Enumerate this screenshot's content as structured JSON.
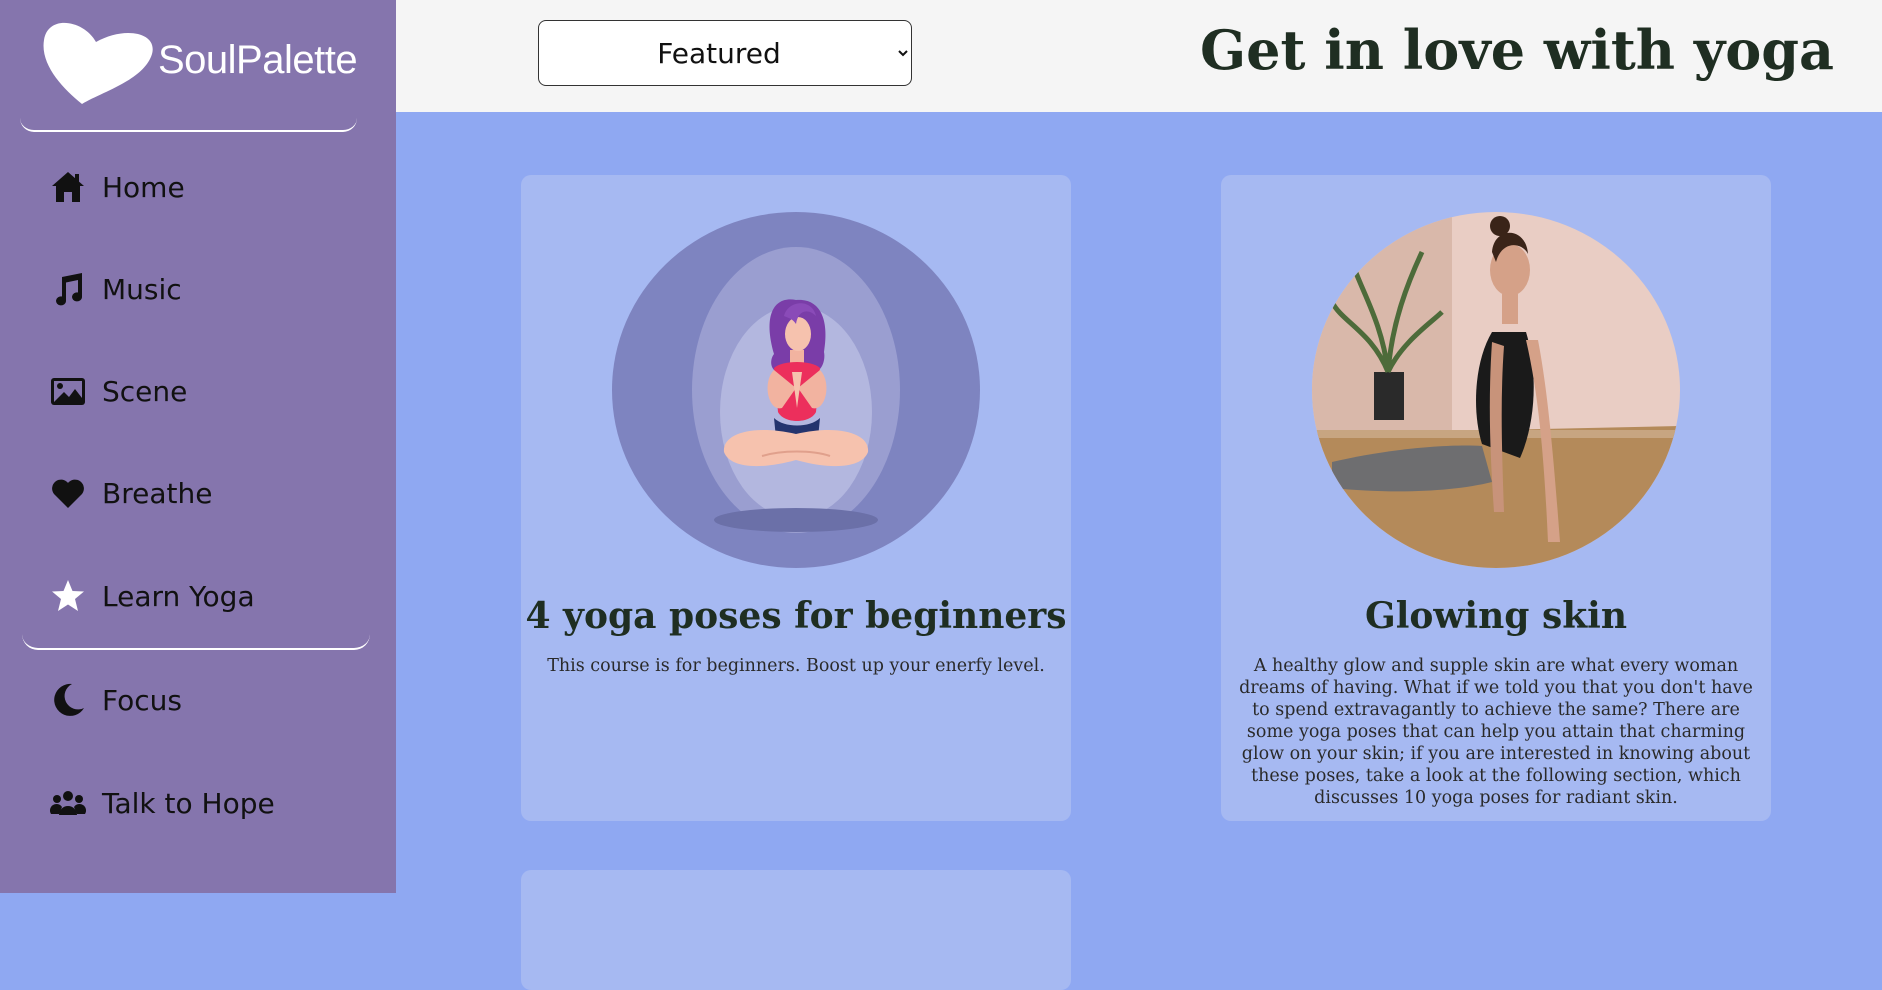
{
  "brand": {
    "name": "SoulPalette",
    "logo_icon": "heart-logo-icon"
  },
  "sidebar": {
    "items": [
      {
        "label": "Home",
        "icon": "home-icon"
      },
      {
        "label": "Music",
        "icon": "music-note-icon"
      },
      {
        "label": "Scene",
        "icon": "image-icon"
      },
      {
        "label": "Breathe",
        "icon": "heart-icon"
      },
      {
        "label": "Learn Yoga",
        "icon": "star-icon",
        "active": true
      },
      {
        "label": "Focus",
        "icon": "moon-icon"
      },
      {
        "label": "Talk to Hope",
        "icon": "people-icon"
      }
    ]
  },
  "header": {
    "sort_selected": "Featured",
    "title": "Get in love with yoga"
  },
  "cards": [
    {
      "title": "4 yoga poses for beginners",
      "description": "This course is for beginners. Boost up your enerfy level.",
      "image": "meditation-illustration"
    },
    {
      "title": "Glowing skin",
      "description": "A healthy glow and supple skin are what every woman dreams of having. What if we told you that you don't have to spend extravagantly to achieve the same? There are some yoga poses that can help you attain that charming glow on your skin; if you are interested in knowing about these poses, take a look at the following section, which discusses 10 yoga poses for radiant skin.",
      "image": "cobra-pose-photo"
    }
  ],
  "colors": {
    "sidebar_bg": "#8575ad",
    "main_bg": "#8fa8f2",
    "card_bg": "#a6b9f2",
    "header_bg": "#f5f5f5",
    "title_text": "#1f2e22"
  }
}
